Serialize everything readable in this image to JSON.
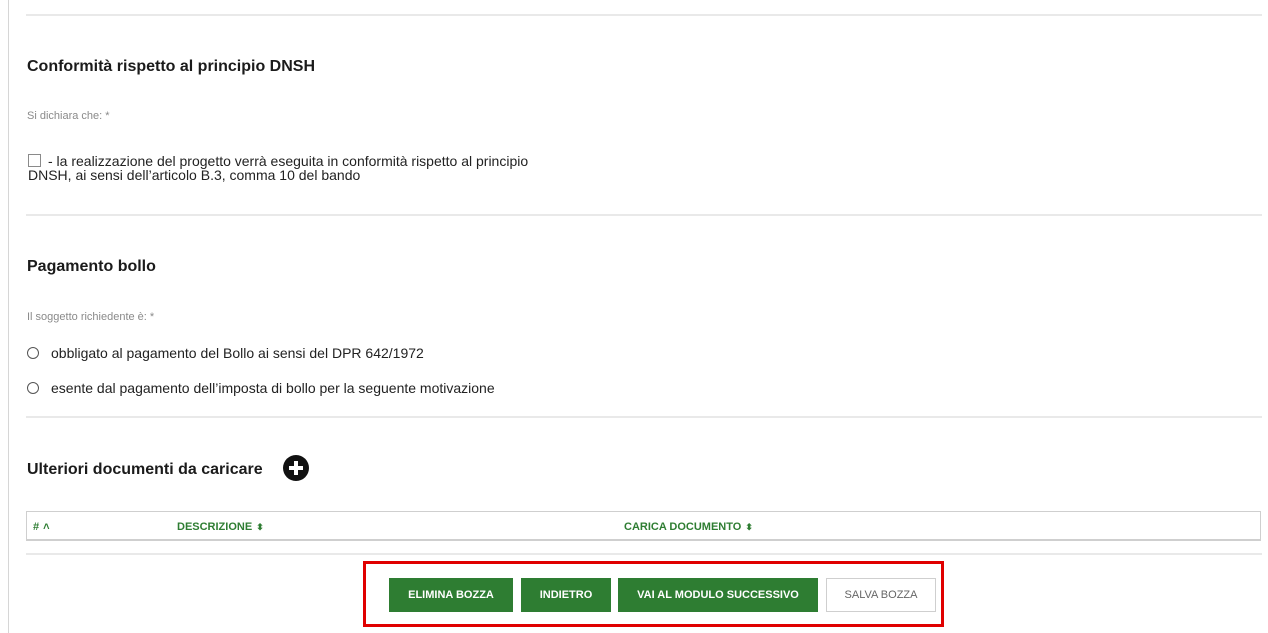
{
  "dnsh": {
    "title": "Conformità rispetto al principio DNSH",
    "hint": "Si dichiara che: *",
    "checkbox_label_line1": "- la realizzazione del progetto verrà eseguita in conformità rispetto al principio",
    "checkbox_label_line2": "DNSH, ai sensi dell’articolo B.3, comma 10 del bando"
  },
  "bollo": {
    "title": "Pagamento bollo",
    "hint": "Il soggetto richiedente è: *",
    "options": [
      "obbligato al pagamento del Bollo ai sensi del DPR 642/1972",
      "esente dal pagamento dell’imposta di bollo per la seguente motivazione"
    ]
  },
  "docs": {
    "title": "Ulteriori documenti da caricare",
    "add_icon": "plus-circle-icon",
    "columns": [
      {
        "label": "#",
        "sort": "up"
      },
      {
        "label": "DESCRIZIONE",
        "sort": "both"
      },
      {
        "label": "CARICA DOCUMENTO",
        "sort": "both"
      }
    ]
  },
  "actions": {
    "delete_draft": "ELIMINA BOZZA",
    "back": "INDIETRO",
    "next_module": "VAI AL MODULO SUCCESSIVO",
    "save_draft": "SALVA BOZZA"
  },
  "colors": {
    "accent_green": "#2e7d32",
    "highlight_red": "#e00000"
  }
}
